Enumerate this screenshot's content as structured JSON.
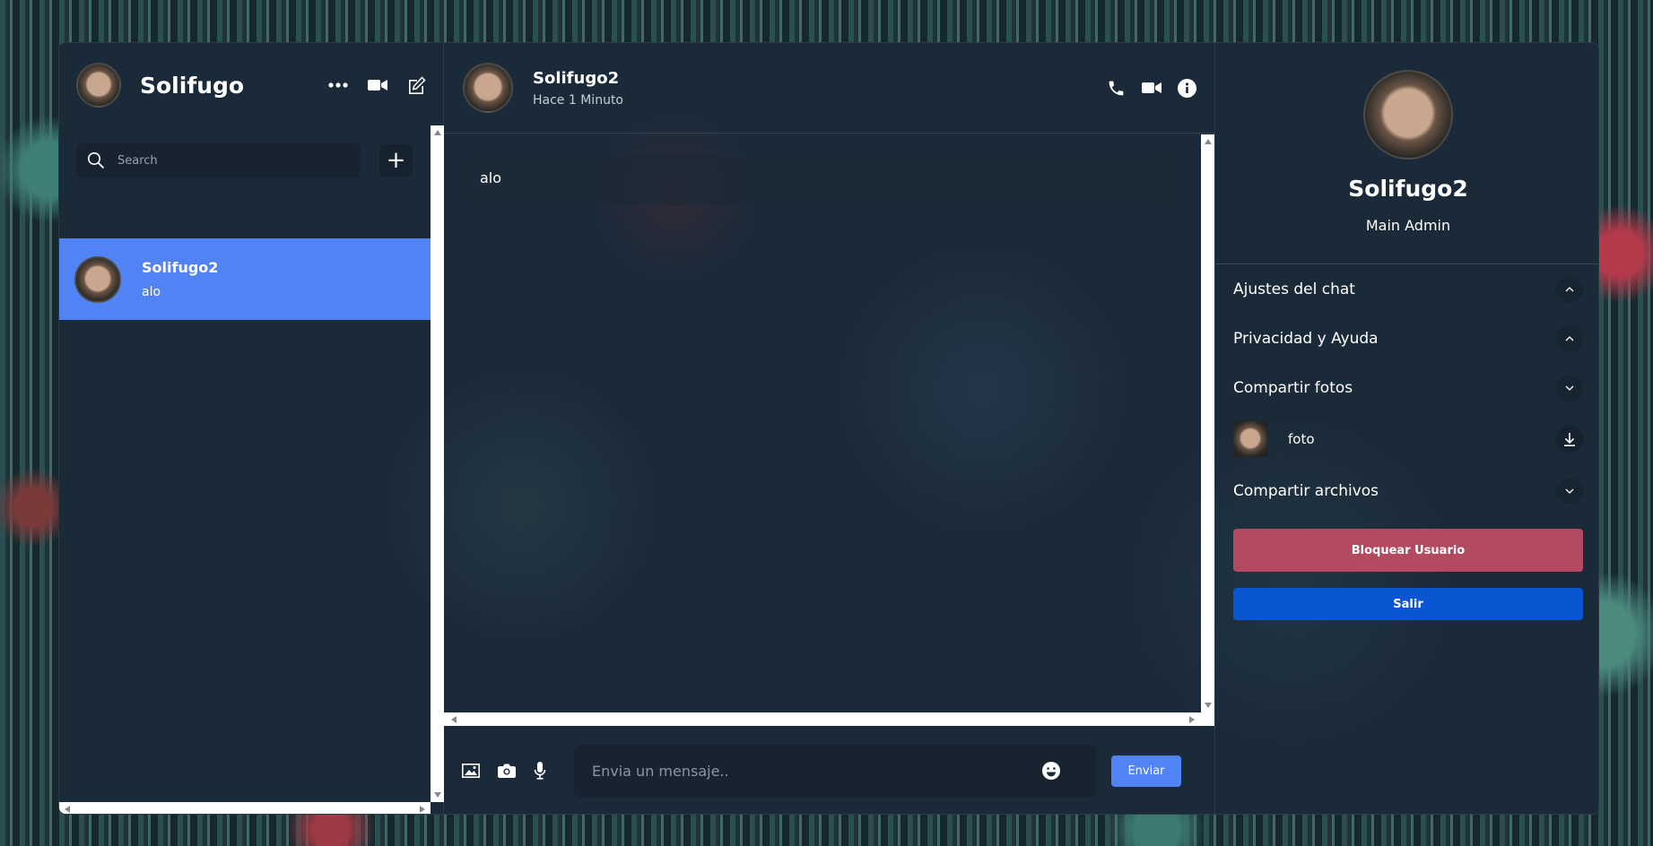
{
  "sidebar": {
    "title": "Solifugo",
    "search_placeholder": "Search",
    "add_label": "+",
    "chats": [
      {
        "name": "Solifugo2",
        "last_message": "alo"
      }
    ]
  },
  "conversation": {
    "name": "Solifugo2",
    "status": "Hace 1 Minuto",
    "messages": [
      {
        "text": "alo"
      }
    ],
    "input_placeholder": "Envia un mensaje..",
    "send_label": "Enviar"
  },
  "details": {
    "name": "Solifugo2",
    "role": "Main Admin",
    "sections": {
      "chat_settings": "Ajustes del chat",
      "privacy": "Privacidad y Ayuda",
      "share_photos": "Compartir fotos",
      "share_files": "Compartir archivos"
    },
    "photo_label": "foto",
    "block_label": "Bloquear Usuario",
    "exit_label": "Salir"
  },
  "colors": {
    "accent": "#5283f5",
    "block": "#b34a5f",
    "exit": "#0a55d1"
  }
}
